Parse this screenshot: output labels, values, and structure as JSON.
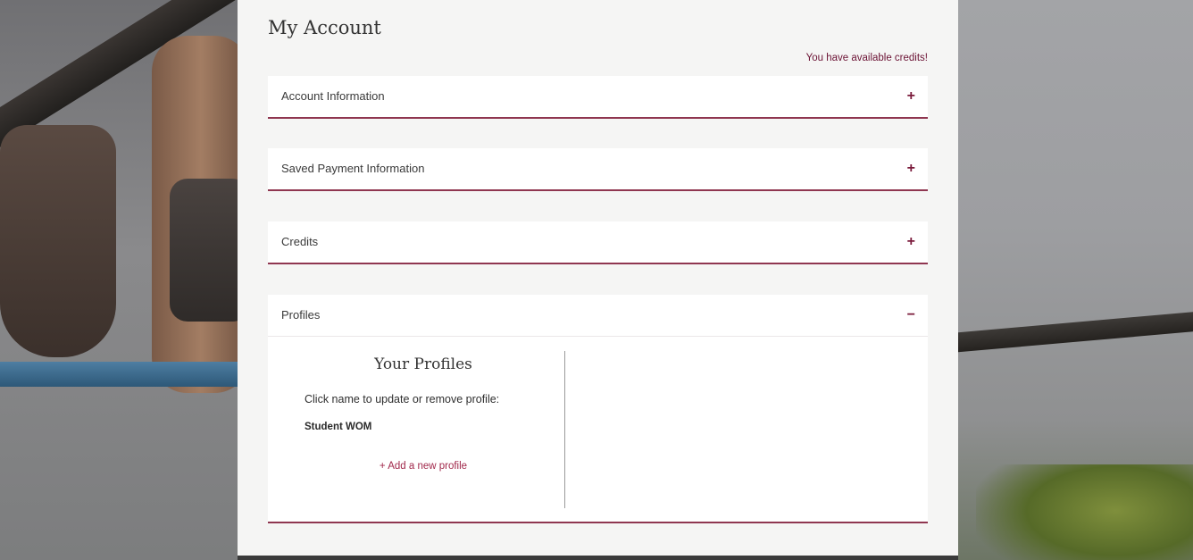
{
  "page": {
    "title": "My Account",
    "credits_notice": "You have available credits!"
  },
  "accordions": [
    {
      "label": "Account Information",
      "toggle": "+",
      "expanded": false
    },
    {
      "label": "Saved Payment Information",
      "toggle": "+",
      "expanded": false
    },
    {
      "label": "Credits",
      "toggle": "+",
      "expanded": false
    }
  ],
  "profiles": {
    "label": "Profiles",
    "toggle": "−",
    "expanded": true,
    "heading": "Your Profiles",
    "instruction": "Click name to update or remove profile:",
    "items": [
      "Student WOM"
    ],
    "add_label": "+ Add a new profile"
  },
  "colors": {
    "accent": "#8f3650",
    "link": "#6b1234",
    "add_link": "#a1284b"
  }
}
